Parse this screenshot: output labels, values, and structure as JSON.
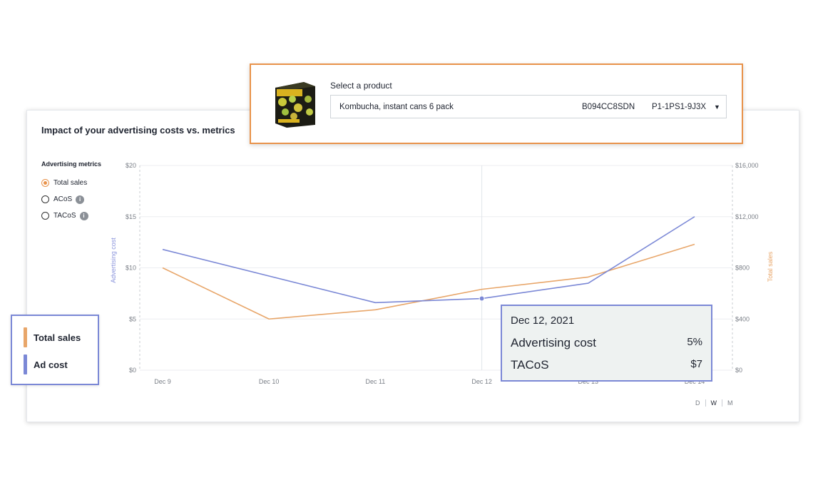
{
  "card": {
    "title": "Impact of your advertising costs vs. metrics",
    "metrics_title": "Advertising metrics",
    "options": [
      {
        "label": "Total sales",
        "selected": true,
        "info": false
      },
      {
        "label": "ACoS",
        "selected": false,
        "info": true
      },
      {
        "label": "TACoS",
        "selected": false,
        "info": true
      }
    ],
    "range_options": [
      "D",
      "W",
      "M"
    ],
    "range_active": "W"
  },
  "product": {
    "select_label": "Select a product",
    "name": "Kombucha, instant cans 6 pack",
    "asin": "B094CC8SDN",
    "sku": "P1-1PS1-9J3X"
  },
  "legend": {
    "items": [
      {
        "label": "Total sales",
        "color": "#e8a66a"
      },
      {
        "label": "Ad cost",
        "color": "#7b88d6"
      }
    ]
  },
  "tooltip": {
    "date": "Dec 12, 2021",
    "rows": [
      {
        "label": "Advertising cost",
        "value": "5%"
      },
      {
        "label": "TACoS",
        "value": "$7"
      }
    ]
  },
  "chart_data": {
    "type": "line",
    "categories": [
      "Dec 9",
      "Dec 10",
      "Dec 11",
      "Dec 12",
      "Dec 13",
      "Dec 14"
    ],
    "ylabel": "Advertising cost",
    "y2label": "Total sales",
    "ylim": [
      0,
      20
    ],
    "y2lim": [
      0,
      16000
    ],
    "yticks": [
      "$0",
      "$5",
      "$10",
      "$15",
      "$20"
    ],
    "y2ticks": [
      "$0",
      "$400",
      "$800",
      "$12,000",
      "$16,000"
    ],
    "grid": true,
    "highlight_index": 3,
    "series": [
      {
        "name": "Ad cost",
        "axis": "left",
        "color": "#7b88d6",
        "values": [
          11.8,
          9.2,
          6.6,
          7.0,
          8.5,
          15.0
        ]
      },
      {
        "name": "Total sales",
        "axis": "left",
        "color": "#e8a66a",
        "values": [
          10.0,
          5.0,
          5.9,
          7.9,
          9.1,
          12.3
        ]
      }
    ]
  }
}
